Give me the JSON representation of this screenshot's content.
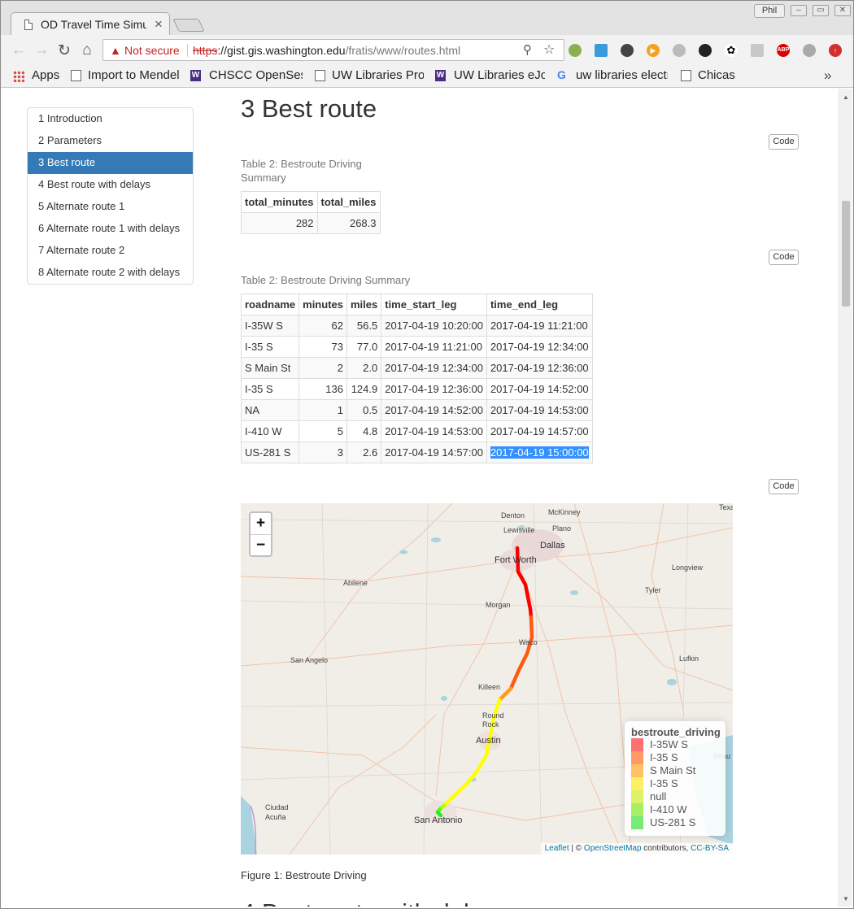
{
  "browser": {
    "tab_title": "OD Travel Time Simu",
    "profile": "Phil",
    "security_label": "Not secure",
    "url_scheme": "https",
    "url_host": "://gist.gis.washington.edu",
    "url_path": "/fratis/www/routes.html",
    "bookmarks": [
      "Apps",
      "Import to Mendel",
      "CHSCC OpenSesa",
      "UW Libraries Prox",
      "UW Libraries eJou",
      "uw libraries electr",
      "Chicas"
    ],
    "extensions": [
      "sync-icon",
      "screenshot-icon",
      "incognito-icon",
      "play-icon",
      "contrast-icon",
      "dark-mode-icon",
      "paw-icon",
      "duplicate-icon",
      "adblock-icon",
      "circle-icon",
      "upload-icon"
    ],
    "adblock_label": "ABP"
  },
  "toc": {
    "items": [
      {
        "label": "1 Introduction",
        "active": false
      },
      {
        "label": "2 Parameters",
        "active": false
      },
      {
        "label": "3 Best route",
        "active": true
      },
      {
        "label": "4 Best route with delays",
        "active": false
      },
      {
        "label": "5 Alternate route 1",
        "active": false
      },
      {
        "label": "6 Alternate route 1 with delays",
        "active": false
      },
      {
        "label": "7 Alternate route 2",
        "active": false
      },
      {
        "label": "8 Alternate route 2 with delays",
        "active": false
      }
    ]
  },
  "section": {
    "title": "3 Best route",
    "code_label": "Code",
    "next_title": "4 Best route with delays"
  },
  "summary_table": {
    "caption": "Table 2: Bestroute Driving Summary",
    "headers": [
      "total_minutes",
      "total_miles"
    ],
    "rows": [
      [
        "282",
        "268.3"
      ]
    ]
  },
  "legs_table": {
    "caption": "Table 2: Bestroute Driving Summary",
    "headers": [
      "roadname",
      "minutes",
      "miles",
      "time_start_leg",
      "time_end_leg"
    ],
    "rows": [
      [
        "I-35W S",
        "62",
        "56.5",
        "2017-04-19 10:20:00",
        "2017-04-19 11:21:00"
      ],
      [
        "I-35 S",
        "73",
        "77.0",
        "2017-04-19 11:21:00",
        "2017-04-19 12:34:00"
      ],
      [
        "S Main St",
        "2",
        "2.0",
        "2017-04-19 12:34:00",
        "2017-04-19 12:36:00"
      ],
      [
        "I-35 S",
        "136",
        "124.9",
        "2017-04-19 12:36:00",
        "2017-04-19 14:52:00"
      ],
      [
        "NA",
        "1",
        "0.5",
        "2017-04-19 14:52:00",
        "2017-04-19 14:53:00"
      ],
      [
        "I-410 W",
        "5",
        "4.8",
        "2017-04-19 14:53:00",
        "2017-04-19 14:57:00"
      ],
      [
        "US-281 S",
        "3",
        "2.6",
        "2017-04-19 14:57:00",
        "2017-04-19 15:00:00"
      ]
    ],
    "selected_cell_text": "2017-04-19 15:00:00"
  },
  "map": {
    "zoom_in": "+",
    "zoom_out": "−",
    "legend_title": "bestroute_driving",
    "legend": [
      {
        "label": "I-35W S",
        "color": "#ff7070"
      },
      {
        "label": "I-35 S",
        "color": "#ff9966"
      },
      {
        "label": "S Main St",
        "color": "#ffc066"
      },
      {
        "label": "I-35 S",
        "color": "#ffee66"
      },
      {
        "label": "null",
        "color": "#ddf266"
      },
      {
        "label": "I-410 W",
        "color": "#a8ef66"
      },
      {
        "label": "US-281 S",
        "color": "#77ea77"
      }
    ],
    "cities": [
      "Denton",
      "McKinney",
      "Texa",
      "Lewisville",
      "Plano",
      "Dallas",
      "Fort Worth",
      "Abilene",
      "Longview",
      "Tyler",
      "Morgan",
      "Waco",
      "San Angelo",
      "Lufkin",
      "Killeen",
      "Round Rock",
      "Austin",
      "Beau",
      "Ciudad Acuña",
      "San Antonio"
    ],
    "attribution_leaflet": "Leaflet",
    "attribution_sep": " | © ",
    "attribution_osm": "OpenStreetMap",
    "attribution_mid": " contributors, ",
    "attribution_license": "CC-BY-SA",
    "route_colors": [
      "#ff0000",
      "#ff5a14",
      "#ff9a1e",
      "#ffff00",
      "#b4ff00",
      "#50ff00",
      "#22ee22"
    ]
  },
  "figure_caption": "Figure 1: Bestroute Driving"
}
